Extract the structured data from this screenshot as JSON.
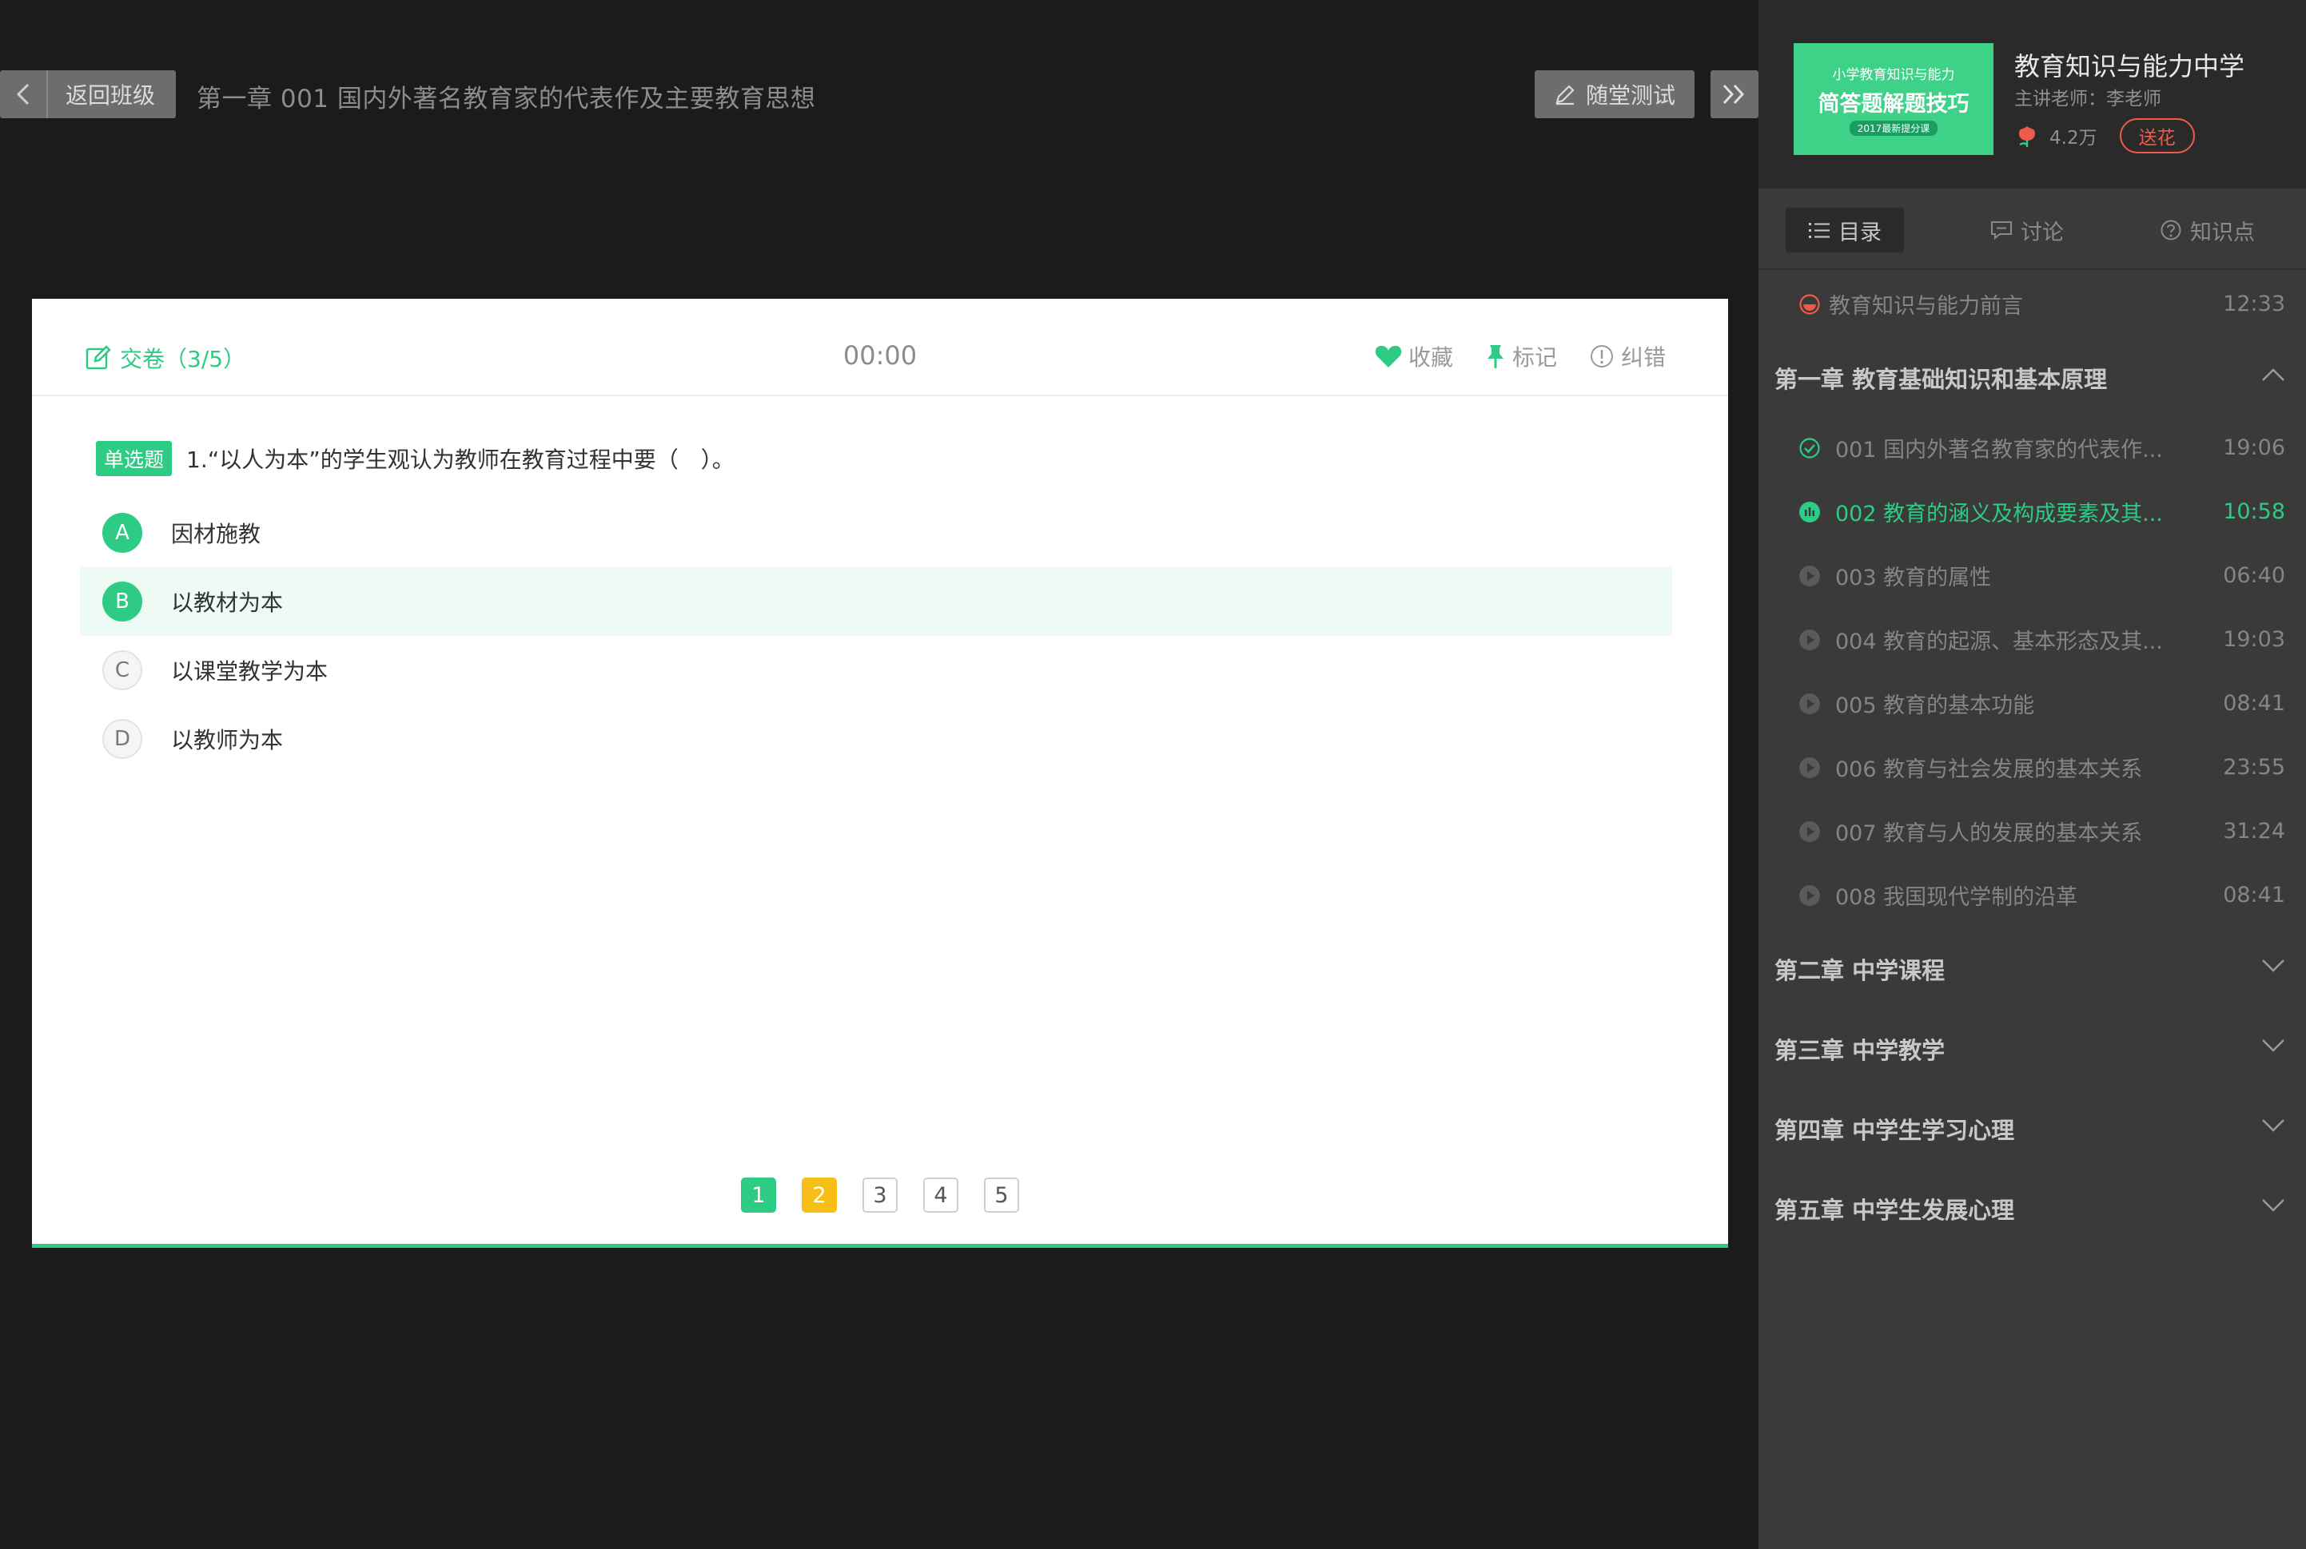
{
  "header": {
    "back_label": "返回班级",
    "lesson_title": "第一章   001 国内外著名教育家的代表作及主要教育思想",
    "quiz_button": "随堂测试"
  },
  "card": {
    "submit_label": "交卷（3/5）",
    "timer": "00:00",
    "actions": {
      "favorite": "收藏",
      "mark": "标记",
      "report": "纠错"
    },
    "question": {
      "type_label": "单选题",
      "text": "1.“以人为本”的学生观认为教师在教育过程中要（　）。",
      "options": [
        {
          "letter": "A",
          "text": "因材施教",
          "style": "answered"
        },
        {
          "letter": "B",
          "text": "以教材为本",
          "style": "selected"
        },
        {
          "letter": "C",
          "text": "以课堂教学为本",
          "style": "normal"
        },
        {
          "letter": "D",
          "text": "以教师为本",
          "style": "normal"
        }
      ]
    },
    "pager": [
      {
        "num": "1",
        "state": "done"
      },
      {
        "num": "2",
        "state": "current"
      },
      {
        "num": "3",
        "state": "todo"
      },
      {
        "num": "4",
        "state": "todo"
      },
      {
        "num": "5",
        "state": "todo"
      }
    ]
  },
  "sidebar": {
    "cover": {
      "line1": "小学教育知识与能力",
      "line2": "简答题解题技巧",
      "line3": "2017最新提分课"
    },
    "course_title": "教育知识与能力中学",
    "teacher": "主讲老师：李老师",
    "flower_count": "4.2万",
    "send_flower": "送花",
    "tabs": {
      "catalog": "目录",
      "discussion": "讨论",
      "knowledge": "知识点"
    },
    "preface": {
      "title": "教育知识与能力前言",
      "duration": "12:33"
    },
    "chapters": [
      {
        "title": "第一章  教育基础知识和基本原理",
        "expanded": true,
        "lessons": [
          {
            "title": "001 国内外著名教育家的代表作...",
            "duration": "19:06",
            "state": "done"
          },
          {
            "title": "002 教育的涵义及构成要素及其...",
            "duration": "10:58",
            "state": "playing"
          },
          {
            "title": "003 教育的属性",
            "duration": "06:40",
            "state": "todo"
          },
          {
            "title": "004 教育的起源、基本形态及其...",
            "duration": "19:03",
            "state": "todo"
          },
          {
            "title": "005 教育的基本功能",
            "duration": "08:41",
            "state": "todo"
          },
          {
            "title": "006 教育与社会发展的基本关系",
            "duration": "23:55",
            "state": "todo"
          },
          {
            "title": "007 教育与人的发展的基本关系",
            "duration": "31:24",
            "state": "todo"
          },
          {
            "title": "008 我国现代学制的沿革",
            "duration": "08:41",
            "state": "todo"
          }
        ]
      },
      {
        "title": "第二章  中学课程",
        "expanded": false
      },
      {
        "title": "第三章  中学教学",
        "expanded": false
      },
      {
        "title": "第四章  中学生学习心理",
        "expanded": false
      },
      {
        "title": "第五章  中学生发展心理",
        "expanded": false
      }
    ]
  },
  "colors": {
    "accent": "#2dcb84",
    "current_page": "#f6be17",
    "flower": "#f05a4a",
    "panel": "#3a3a3a"
  }
}
